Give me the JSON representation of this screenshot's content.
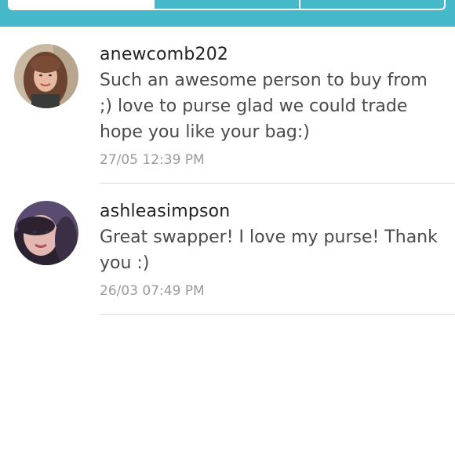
{
  "colors": {
    "accent": "#45b8c9",
    "divider": "#d9d9d9",
    "timestamp": "#9a9a9a"
  },
  "tabs": [
    {
      "label": "",
      "active": true
    },
    {
      "label": "",
      "active": false
    },
    {
      "label": "",
      "active": false
    }
  ],
  "reviews": [
    {
      "username": "anewcomb202",
      "comment": "Such an awesome person to buy from ;) love to purse glad we could trade hope you like your bag:)",
      "timestamp": "27/05 12:39 PM",
      "avatar": "avatar-photo"
    },
    {
      "username": "ashleasimpson",
      "comment": "Great swapper! I love my purse! Thank you :)",
      "timestamp": "26/03 07:49 PM",
      "avatar": "avatar-photo"
    }
  ]
}
